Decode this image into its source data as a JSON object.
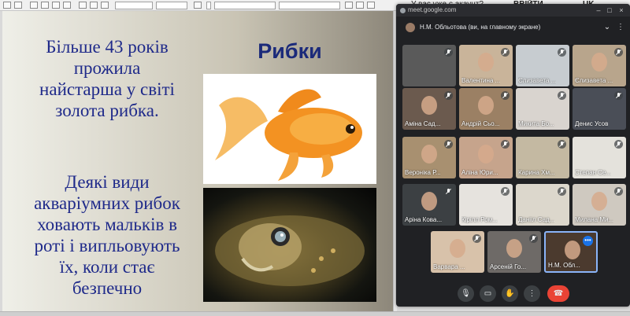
{
  "toolbar": {
    "right_prompt": "У вас уже є акаунт?",
    "right_link": "ВВІЙТИ",
    "right_lang": "UK"
  },
  "slide": {
    "title": "Рибки",
    "paragraph1_lines": [
      "Більше 43 років",
      "прожила",
      "найстарша у світі",
      "золота рибка."
    ],
    "paragraph2_lines": [
      "Деякі види",
      "акваріумних рибок",
      "ховають мальків в",
      "роті і випльовують",
      "їх, коли стає",
      "безпечно"
    ],
    "image1_alt": "goldfish",
    "image2_alt": "fish"
  },
  "meet": {
    "url": "meet.google.com",
    "presenter_label": "Н.М. Обльотова (ви, на главному экране)",
    "tiles": [
      {
        "name": "",
        "bg": "#5a5a5a"
      },
      {
        "name": "Валентина ...",
        "bg": "#c9b49a"
      },
      {
        "name": "Єлизавета ...",
        "bg": "#c7ccd0"
      },
      {
        "name": "Єлизавета ...",
        "bg": "#b8a58c"
      },
      {
        "name": "Аміна Сад...",
        "bg": "#6b5a4e"
      },
      {
        "name": "Андрій Сьо...",
        "bg": "#9b8064"
      },
      {
        "name": "Микита Бо...",
        "bg": "#d9d4cf"
      },
      {
        "name": "Денис Усов",
        "bg": "#4a4e57"
      },
      {
        "name": "Вероніка Р...",
        "bg": "#a89070"
      },
      {
        "name": "Аліна Юри...",
        "bg": "#c6a48c"
      },
      {
        "name": "Карина Хм...",
        "bg": "#c4b9a2"
      },
      {
        "name": "Степан Се...",
        "bg": "#e4e2dc"
      },
      {
        "name": "Аріна Кова...",
        "bg": "#3c4043"
      },
      {
        "name": "Кірілл Ром...",
        "bg": "#e6e3de"
      },
      {
        "name": "Данііл Сад...",
        "bg": "#dcd7cc"
      },
      {
        "name": "Милана Ми...",
        "bg": "#cfc9c0"
      },
      {
        "name": "Варвара ...",
        "bg": "#d8c2aa"
      },
      {
        "name": "Арсеній Го...",
        "bg": "#6e6a67"
      },
      {
        "name": "Н.М. Обл...",
        "bg": "#4b3a2e"
      }
    ],
    "controls": [
      "mic",
      "camera",
      "raise-hand",
      "more",
      "end-call"
    ]
  },
  "colors": {
    "slide_text": "#1f2a8a",
    "meet_bg": "#202124",
    "end_call": "#ea4335",
    "self_border": "#8ab4f8"
  }
}
